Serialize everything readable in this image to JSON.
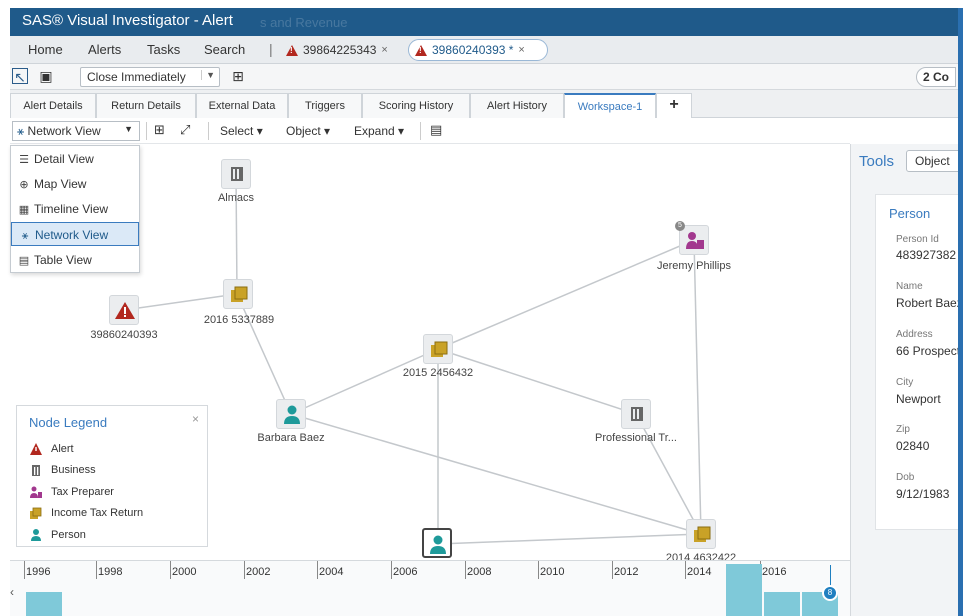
{
  "titlebar": {
    "title": "SAS® Visual Investigator - Alert",
    "ghost_text": "s and Revenue"
  },
  "menubar": {
    "items": [
      "Home",
      "Alerts",
      "Tasks",
      "Search"
    ],
    "separator": "|",
    "doc_tabs": [
      {
        "label": "39864225343",
        "close": "×"
      },
      {
        "label": "39860240393 *",
        "close": "×"
      }
    ]
  },
  "toolbar": {
    "close_option": "Close Immediately",
    "right_pill": "2 Co"
  },
  "page_tabs": [
    "Alert Details",
    "Return Details",
    "External Data",
    "Triggers",
    "Scoring History",
    "Alert History",
    "Workspace-1"
  ],
  "add_tab": "+",
  "view_toolbar": {
    "view_select": "Network View",
    "select_menu": "Select",
    "object_menu": "Object",
    "expand_menu": "Expand"
  },
  "view_menu": {
    "items": [
      {
        "label": "Detail View",
        "icon": "list-icon",
        "glyph": "☰"
      },
      {
        "label": "Map View",
        "icon": "globe-icon",
        "glyph": "⊕"
      },
      {
        "label": "Timeline View",
        "icon": "calendar-icon",
        "glyph": "▦"
      },
      {
        "label": "Network View",
        "icon": "network-icon",
        "glyph": "⚹"
      },
      {
        "label": "Table View",
        "icon": "table-icon",
        "glyph": "▤"
      }
    ]
  },
  "nodes": [
    {
      "id": "almacs",
      "type": "Business",
      "label": "Almacs"
    },
    {
      "id": "return2016",
      "type": "Income Tax Return",
      "label": "2016 5337889"
    },
    {
      "id": "alert",
      "type": "Alert",
      "label": "39860240393"
    },
    {
      "id": "return2015",
      "type": "Income Tax Return",
      "label": "2015 2456432"
    },
    {
      "id": "jeremy",
      "type": "Tax Preparer",
      "label": "Jeremy Phillips",
      "badge": "5"
    },
    {
      "id": "barbara",
      "type": "Person",
      "label": "Barbara Baez"
    },
    {
      "id": "professional",
      "type": "Business",
      "label": "Professional Tr..."
    },
    {
      "id": "return2014",
      "type": "Income Tax Return",
      "label": "2014 4632422"
    },
    {
      "id": "person_bottom",
      "type": "Person",
      "label": ""
    }
  ],
  "legend": {
    "title": "Node Legend",
    "close": "×",
    "items": [
      {
        "label": "Alert",
        "color": "#b2281f"
      },
      {
        "label": "Business",
        "color": "#666666"
      },
      {
        "label": "Tax Preparer",
        "color": "#a2388e"
      },
      {
        "label": "Income Tax Return",
        "color": "#c9a227"
      },
      {
        "label": "Person",
        "color": "#1e9a9a"
      }
    ]
  },
  "timeline": {
    "years": [
      "1996",
      "1998",
      "2000",
      "2002",
      "2004",
      "2006",
      "2008",
      "2010",
      "2012",
      "2014",
      "2016"
    ],
    "handle_label": "8"
  },
  "tools": {
    "title": "Tools",
    "object_button": "Object"
  },
  "person_panel": {
    "title": "Person",
    "fields": [
      {
        "label": "Person Id",
        "value": "483927382"
      },
      {
        "label": "Name",
        "value": "Robert Baez"
      },
      {
        "label": "Address",
        "value": "66 Prospect"
      },
      {
        "label": "City",
        "value": "Newport"
      },
      {
        "label": "Zip",
        "value": "02840"
      },
      {
        "label": "Dob",
        "value": "9/12/1983"
      }
    ]
  },
  "colors": {
    "titlebar": "#1f5a8a",
    "accent": "#3a7bbf",
    "alert": "#b2281f",
    "return": "#c9a227",
    "person": "#1e9a9a",
    "preparer": "#a2388e",
    "business": "#666666",
    "timeline_bar": "#7fc9d9"
  }
}
